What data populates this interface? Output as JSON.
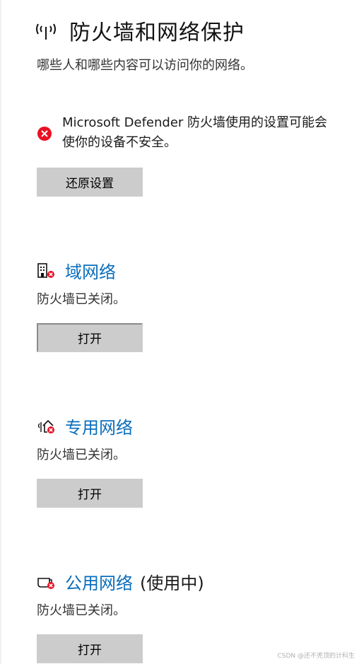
{
  "header": {
    "title": "防火墙和网络保护",
    "icon": "wifi-antenna-icon"
  },
  "subtitle": "哪些人和哪些内容可以访问你的网络。",
  "warning": {
    "icon": "error-circle-icon",
    "color": "#e81123",
    "line1": "Microsoft Defender 防火墙使用的设置可能会",
    "line2": "使你的设备不安全。"
  },
  "restore_button": "还原设置",
  "networks": {
    "domain": {
      "title": "域网络",
      "suffix": "",
      "status": "防火墙已关闭。",
      "button": "打开",
      "icon": "building-error-icon"
    },
    "private": {
      "title": "专用网络",
      "suffix": "",
      "status": "防火墙已关闭。",
      "button": "打开",
      "icon": "home-error-icon"
    },
    "public": {
      "title": "公用网络",
      "suffix": "(使用中)",
      "status": "防火墙已关闭。",
      "button": "打开",
      "icon": "coffee-cup-error-icon"
    }
  },
  "watermark": "CSDN @还不秃顶的计科生",
  "colors": {
    "link": "#0a6ebd",
    "button_bg": "#cccccc",
    "error": "#e81123"
  }
}
